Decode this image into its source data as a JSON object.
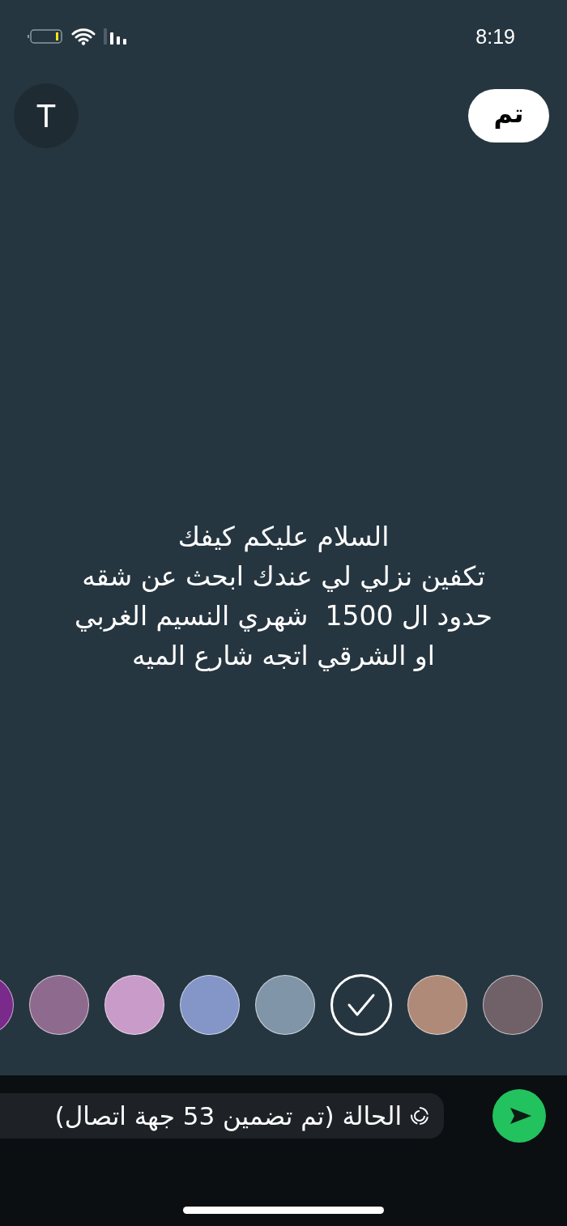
{
  "status_bar": {
    "time": "8:19"
  },
  "toolbar": {
    "font_button": "T",
    "done_button": "تم"
  },
  "message": {
    "text": "السلام عليكم كيفك\nتكفين نزلي لي عندك ابحث عن شقه\nحدود ال 1500  شهري النسيم الغربي\nاو الشرقي اتجه شارع الميه"
  },
  "colors": [
    {
      "color": "#7a2a8a",
      "selected": false
    },
    {
      "color": "#8e6a8e",
      "selected": false
    },
    {
      "color": "#c89bc8",
      "selected": false
    },
    {
      "color": "#8495c8",
      "selected": false
    },
    {
      "color": "#8195a8",
      "selected": false
    },
    {
      "color": "#263640",
      "selected": true
    },
    {
      "color": "#b08a78",
      "selected": false
    },
    {
      "color": "#706068",
      "selected": false
    }
  ],
  "audience_chip": {
    "text": "الحالة (تم تضمين 53 جهة اتصال)"
  }
}
